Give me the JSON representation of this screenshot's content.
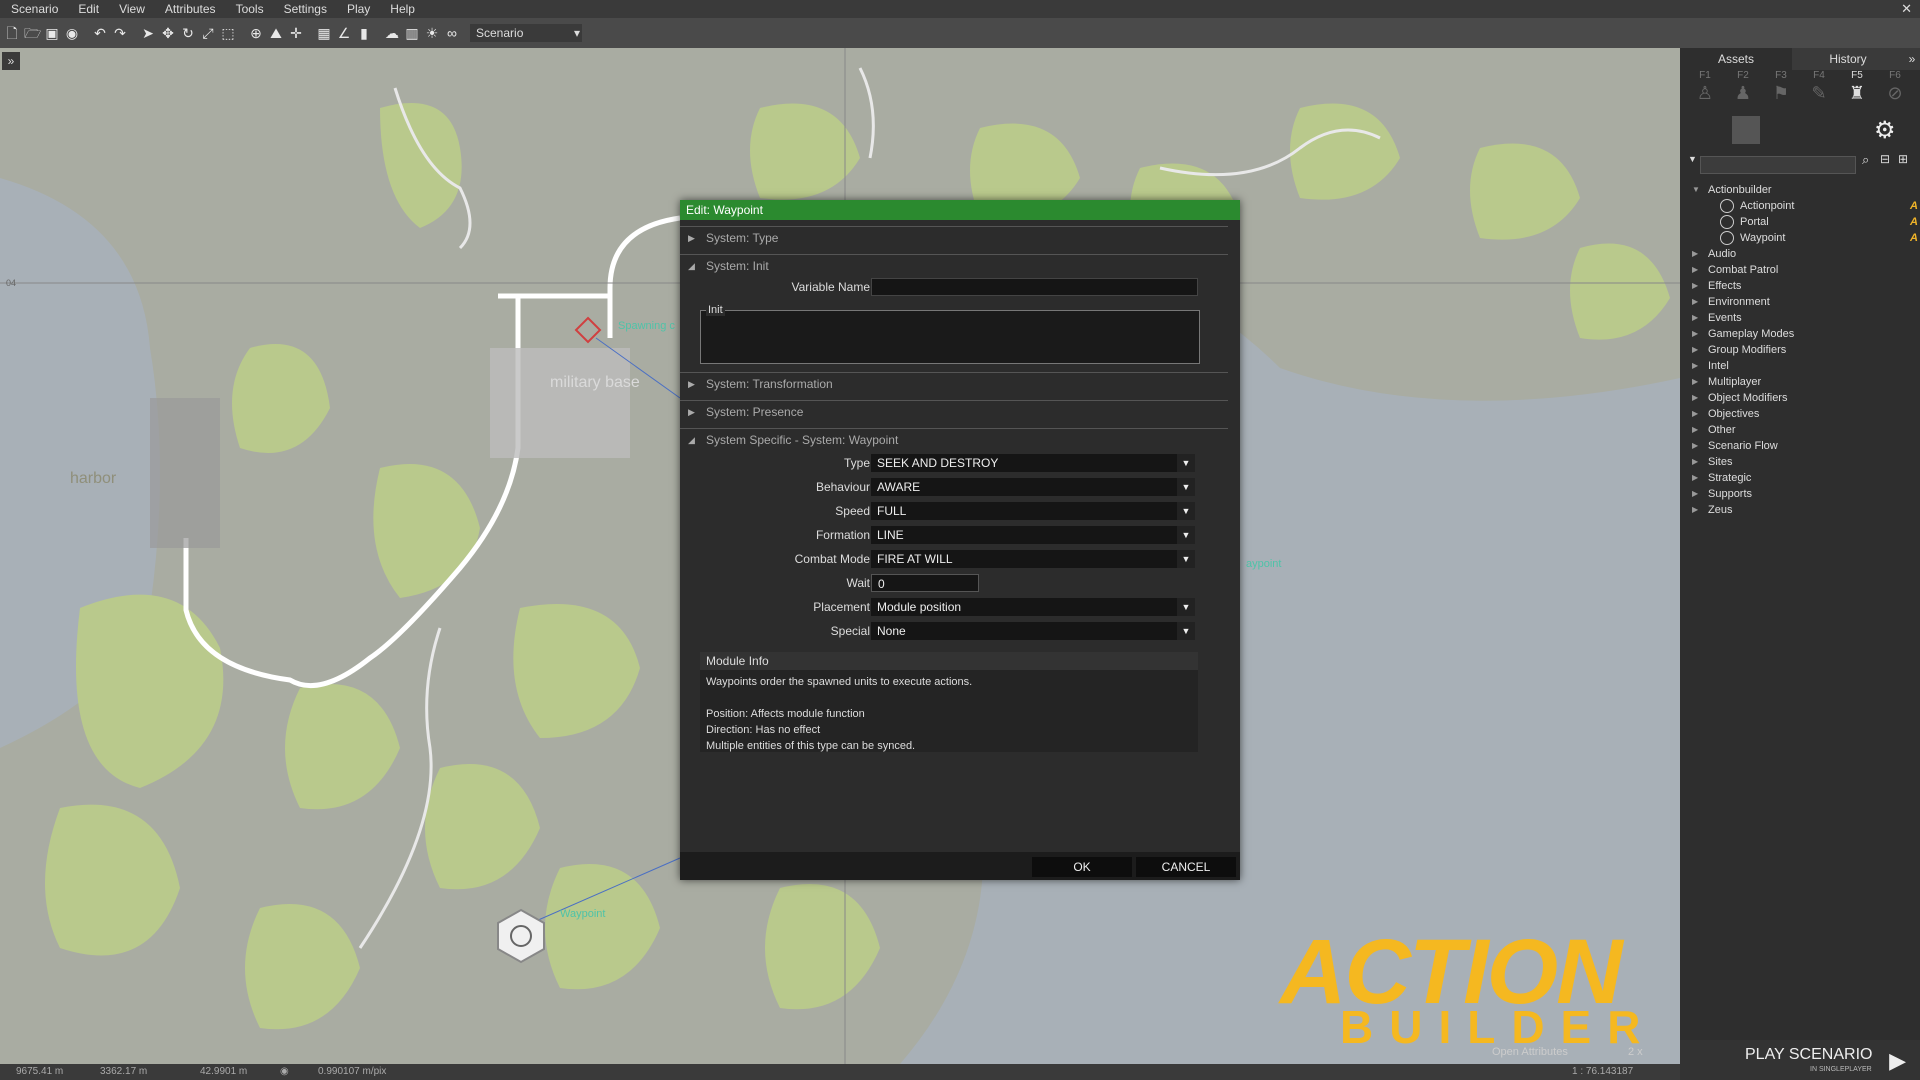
{
  "menu": [
    "Scenario",
    "Edit",
    "View",
    "Attributes",
    "Tools",
    "Settings",
    "Play",
    "Help"
  ],
  "toolbar": {
    "scenario_value": "Scenario"
  },
  "map": {
    "labels": {
      "harbor": "harbor",
      "military_base": "military base",
      "spawning": "Spawning c",
      "waypoint_lower": "Waypoint",
      "waypoint_right": "aypoint",
      "grid": "04"
    },
    "collapse": "»"
  },
  "right_panel": {
    "tabs": [
      "Assets",
      "History"
    ],
    "collapse": "»",
    "fkeys": [
      "F1",
      "F2",
      "F3",
      "F4",
      "F5",
      "F6"
    ],
    "tree": [
      {
        "label": "Actionbuilder",
        "expanded": true,
        "children": [
          "Actionpoint",
          "Portal",
          "Waypoint"
        ]
      },
      {
        "label": "Audio"
      },
      {
        "label": "Combat Patrol"
      },
      {
        "label": "Effects"
      },
      {
        "label": "Environment"
      },
      {
        "label": "Events"
      },
      {
        "label": "Gameplay Modes"
      },
      {
        "label": "Group Modifiers"
      },
      {
        "label": "Intel"
      },
      {
        "label": "Multiplayer"
      },
      {
        "label": "Object Modifiers"
      },
      {
        "label": "Objectives"
      },
      {
        "label": "Other"
      },
      {
        "label": "Scenario Flow"
      },
      {
        "label": "Sites"
      },
      {
        "label": "Strategic"
      },
      {
        "label": "Supports"
      },
      {
        "label": "Zeus"
      }
    ],
    "play": {
      "title": "PLAY SCENARIO",
      "subtitle": "IN SINGLEPLAYER"
    }
  },
  "dialog": {
    "title": "Edit: Waypoint",
    "sections": {
      "type": "System: Type",
      "init": "System: Init",
      "transformation": "System: Transformation",
      "presence": "System: Presence",
      "specific": "System Specific - System: Waypoint"
    },
    "variable_name_label": "Variable Name",
    "variable_name_value": "",
    "init_label": "Init",
    "fields": [
      {
        "label": "Type",
        "value": "SEEK AND DESTROY"
      },
      {
        "label": "Behaviour",
        "value": "AWARE"
      },
      {
        "label": "Speed",
        "value": "FULL"
      },
      {
        "label": "Formation",
        "value": "LINE"
      },
      {
        "label": "Combat Mode",
        "value": "FIRE AT WILL"
      }
    ],
    "wait_label": "Wait",
    "wait_value": "0",
    "placement_label": "Placement",
    "placement_value": "Module position",
    "special_label": "Special",
    "special_value": "None",
    "module_info": {
      "title": "Module Info",
      "lines": [
        "Waypoints order the spawned units to execute actions.",
        "",
        "Position: Affects module function",
        "Direction: Has no effect",
        "Multiple entities of this type can be synced."
      ]
    },
    "ok": "OK",
    "cancel": "CANCEL"
  },
  "status": {
    "x": "9675.41 m",
    "y": "3362.17 m",
    "z": "42.9901 m",
    "scale": "0.990107 m/pix",
    "open_attributes": "Open Attributes",
    "zoom": "2 x",
    "ratio": "1 : 76.143187"
  },
  "logo": {
    "line1": "ACTION",
    "line2": "BUILDER"
  },
  "colors": {
    "dialog_title": "#2b8a2f",
    "logo": "#f5b820",
    "map_green": "#b9c98c",
    "map_water": "#a9b0b8"
  }
}
